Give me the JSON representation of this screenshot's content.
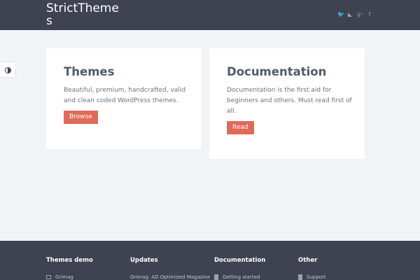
{
  "header": {
    "logo": "StrictThemes",
    "social": [
      {
        "icon": "twitter-icon",
        "glyph": "🐦"
      },
      {
        "icon": "rss-icon",
        "glyph": "◣"
      },
      {
        "icon": "google-plus-icon",
        "glyph": "g⁺"
      },
      {
        "icon": "facebook-icon",
        "glyph": "f"
      }
    ]
  },
  "cards": [
    {
      "title": "Themes",
      "text": "Beautiful, premium, handcrafted, valid and clean coded WordPress themes.",
      "button": "Browse"
    },
    {
      "title": "Documentation",
      "text": "Documentation is the first aid for beginners and others. Must read first of all.",
      "button": "Read"
    }
  ],
  "footer": {
    "columns": [
      {
        "heading": "Themes demo",
        "item": "Grimag"
      },
      {
        "heading": "Updates",
        "item": "Grimag: AD Optimized Magazine"
      },
      {
        "heading": "Documentation",
        "item": "Getting started"
      },
      {
        "heading": "Other",
        "item": "Support"
      }
    ]
  },
  "colors": {
    "header_bg": "#3e4251",
    "page_bg": "#f1f4f7",
    "button_bg": "#e06a58"
  }
}
